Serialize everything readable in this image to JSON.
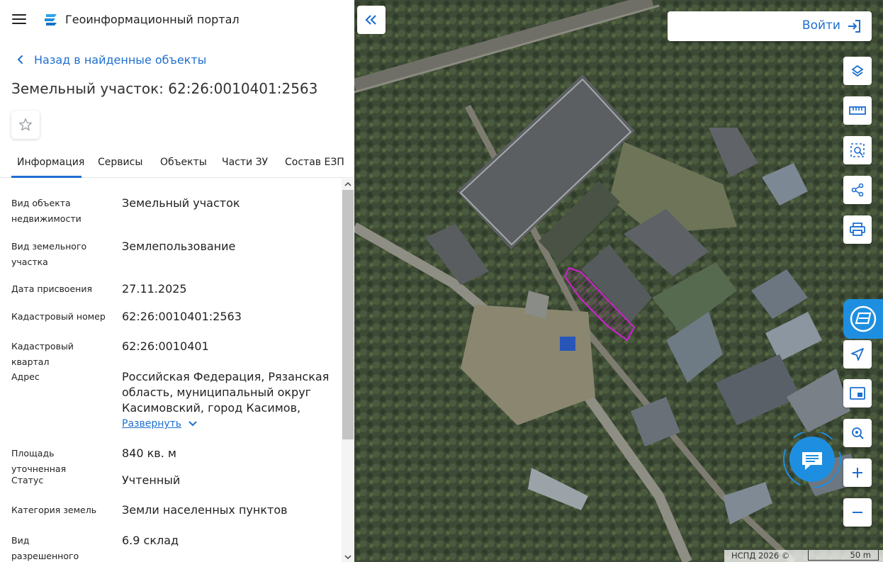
{
  "header": {
    "app_title": "Геоинформационный портал",
    "menu_icon": "hamburger-icon",
    "logo_icon": "portal-logo-icon"
  },
  "nav": {
    "back_label": "Назад в найденные объекты"
  },
  "object": {
    "title": "Земельный участок: 62:26:0010401:2563"
  },
  "tabs": [
    {
      "label": "Информация",
      "active": true
    },
    {
      "label": "Сервисы",
      "active": false
    },
    {
      "label": "Объекты",
      "active": false
    },
    {
      "label": "Части ЗУ",
      "active": false
    },
    {
      "label": "Состав ЕЗП",
      "active": false
    }
  ],
  "attributes": [
    {
      "label": "Вид объекта недвижимости",
      "value": "Земельный участок"
    },
    {
      "label": "Вид земельного участка",
      "value": "Землепользование"
    },
    {
      "label": "Дата присвоения",
      "value": "27.11.2025"
    },
    {
      "label": "Кадастровый номер",
      "value": "62:26:0010401:2563"
    },
    {
      "label": "Кадастровый квартал",
      "value": "62:26:0010401"
    },
    {
      "label": "Адрес",
      "value": "Российская Федерация, Рязанская область, муниципальный округ Касимовский, город Касимов, улица"
    },
    {
      "label": "Площадь уточненная",
      "value": "840 кв. м"
    },
    {
      "label": "Статус",
      "value": "Учтенный"
    },
    {
      "label": "Категория земель",
      "value": "Земли населенных пунктов"
    },
    {
      "label": "Вид разрешенного использования",
      "value": "6.9 склад"
    }
  ],
  "expand_label": "Развернуть",
  "map": {
    "login_label": "Войти",
    "attribution": "НСПД 2026 ©",
    "scale_label": "50 m",
    "tools": [
      "layers-icon",
      "ruler-icon",
      "select-area-icon",
      "share-icon",
      "print-icon",
      "pkk-icon",
      "locate-icon",
      "minimap-icon",
      "search-location-icon",
      "zoom-in-icon",
      "zoom-out-icon"
    ],
    "parcel_color": "#d020d0",
    "accent_color": "#1e6fd0"
  }
}
